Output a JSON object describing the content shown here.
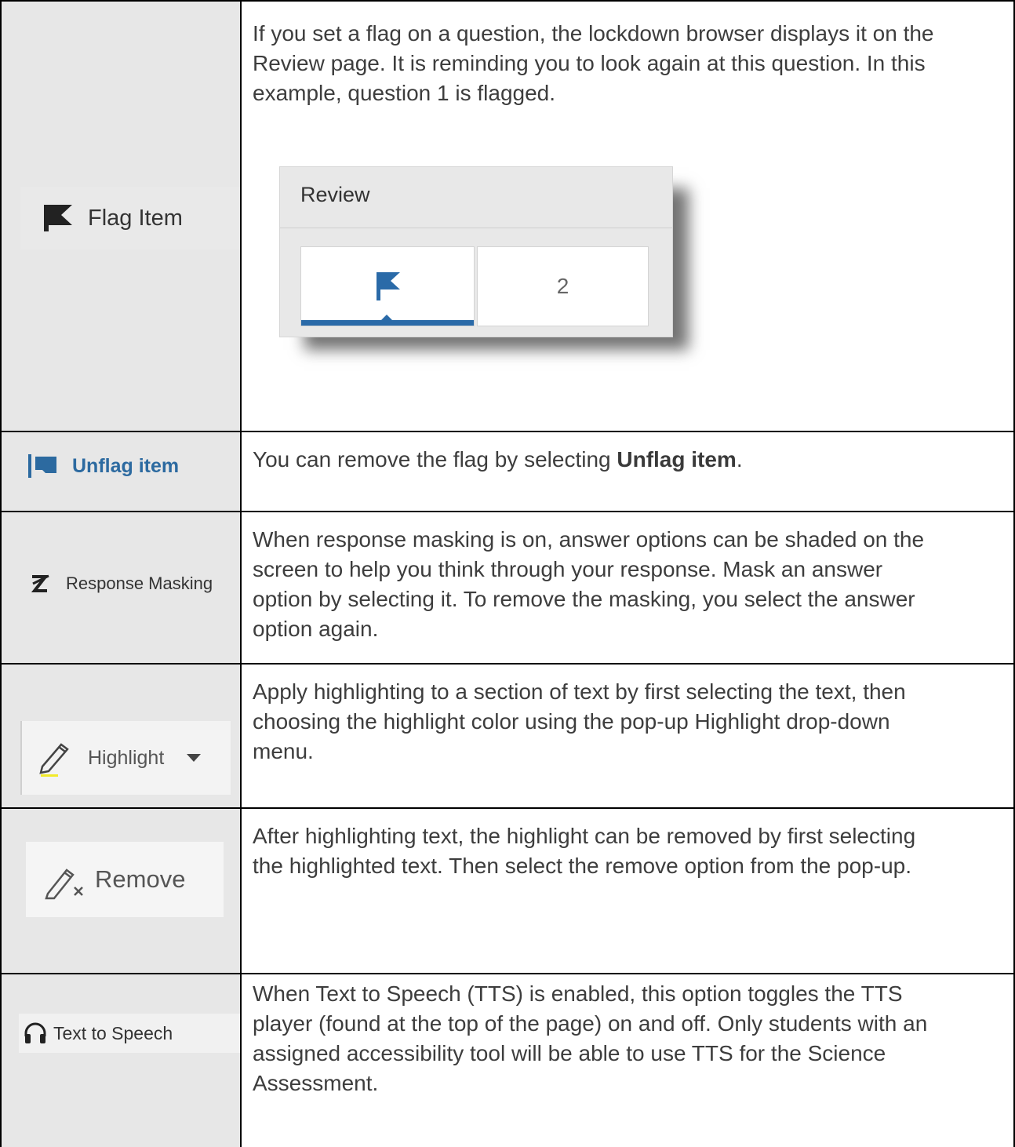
{
  "rows": [
    {
      "tool_label": "Flag Item",
      "tool_icon": "flag-icon",
      "description": "If you set a flag on a question, the lockdown browser displays it on the Review page. It is reminding you to look again at this question. In this example, question 1 is flagged.",
      "review_panel": {
        "title": "Review",
        "cells": [
          "",
          "2"
        ],
        "accent_color": "#2a6aa8"
      }
    },
    {
      "tool_label": "Unflag item",
      "tool_icon": "unflag-icon",
      "description_prefix": "You can remove the flag by selecting ",
      "description_bold": "Unflag item",
      "description_suffix": ".",
      "color": "#2c6aa0"
    },
    {
      "tool_label": "Response Masking",
      "tool_icon": "response-masking-icon",
      "description": "When response masking is on, answer options can be shaded on the screen to help you think through your response. Mask an answer option by selecting it. To remove the masking, you select the answer option again."
    },
    {
      "tool_label": "Highlight",
      "tool_icon": "highlighter-pen-icon",
      "description": "Apply highlighting to a section of text by first selecting the text, then choosing the highlight color using the pop-up Highlight drop-down menu."
    },
    {
      "tool_label": "Remove",
      "tool_icon": "remove-highlight-icon",
      "description": "After highlighting text, the highlight can be removed by first selecting the highlighted text. Then select the remove option from the pop-up."
    },
    {
      "tool_label": "Text to Speech",
      "tool_icon": "headphones-icon",
      "description": "When Text to Speech (TTS) is enabled, this option toggles the TTS player (found at the top of the page) on and off. Only students with an assigned accessibility tool will be able to use TTS for the Science Assessment."
    }
  ]
}
